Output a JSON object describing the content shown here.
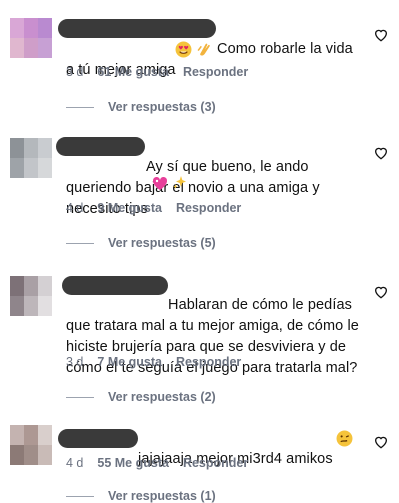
{
  "comments": [
    {
      "text": "Como robarle la vida\na tú mejor amiga",
      "time": "3 d",
      "likes": "61 Me gusta",
      "reply": "Responder",
      "view_replies": "Ver respuestas (3)"
    },
    {
      "text": "Ay sí que bueno, le ando\nqueriendo bajar el novio a una amiga y\nnecesito tips",
      "time": "4 d",
      "likes": "9 Me gusta",
      "reply": "Responder",
      "view_replies": "Ver respuestas (5)"
    },
    {
      "text": "Hablaran de cómo le pedías\nque tratara mal a tu mejor amiga, de cómo le\nhiciste brujería para que se desviviera y de\ncómo el te seguía el juego para tratarla mal?",
      "time": "3 d",
      "likes": "7 Me gusta",
      "reply": "Responder",
      "view_replies": "Ver respuestas (2)"
    },
    {
      "text": "jajajaaja mejor mi3rd4 amikos",
      "time": "4 d",
      "likes": "55 Me gusta",
      "reply": "Responder",
      "view_replies": "Ver respuestas (1)"
    }
  ],
  "icons": {
    "like": "heart-outline-icon",
    "emoji_1a": "heart-eyes-emoji",
    "emoji_1b": "clapping-hands-emoji",
    "emoji_2a": "sparkling-heart-emoji",
    "emoji_2b": "sparkles-emoji",
    "emoji_4": "woozy-face-emoji"
  },
  "colors": {
    "text": "#111111",
    "muted": "#6b7280",
    "redaction": "#3a3a3a"
  }
}
